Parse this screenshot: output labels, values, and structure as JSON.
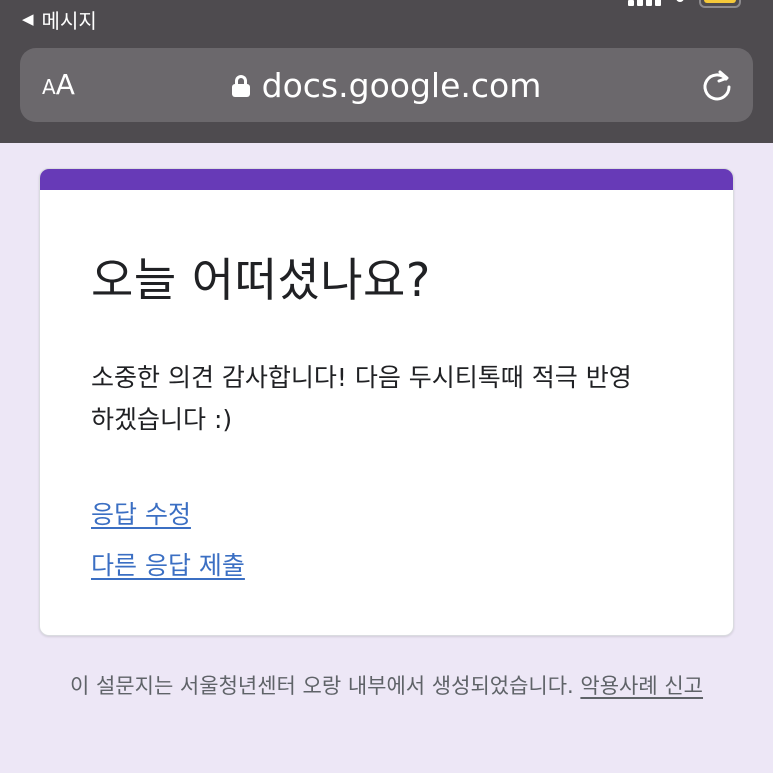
{
  "status_bar": {
    "back_label": "메시지",
    "battery_color": "#f5c93a"
  },
  "browser": {
    "text_size_label_small": "A",
    "text_size_label_big": "A",
    "url": "docs.google.com",
    "icons": [
      "lock-icon",
      "reload-icon"
    ]
  },
  "form": {
    "accent_color": "#673ab7",
    "title": "오늘 어떠셨나요?",
    "confirmation_line1": "소중한 의견 감사합니다! 다음 두시티톡때 적극 반영",
    "confirmation_line2": "하겠습니다 :)",
    "edit_response_link": "응답 수정",
    "submit_another_link": "다른 응답 제출"
  },
  "footer": {
    "notice": "이 설문지는 서울청년센터 오랑 내부에서 생성되었습니다.",
    "report_abuse_link": "악용사례 신고"
  }
}
